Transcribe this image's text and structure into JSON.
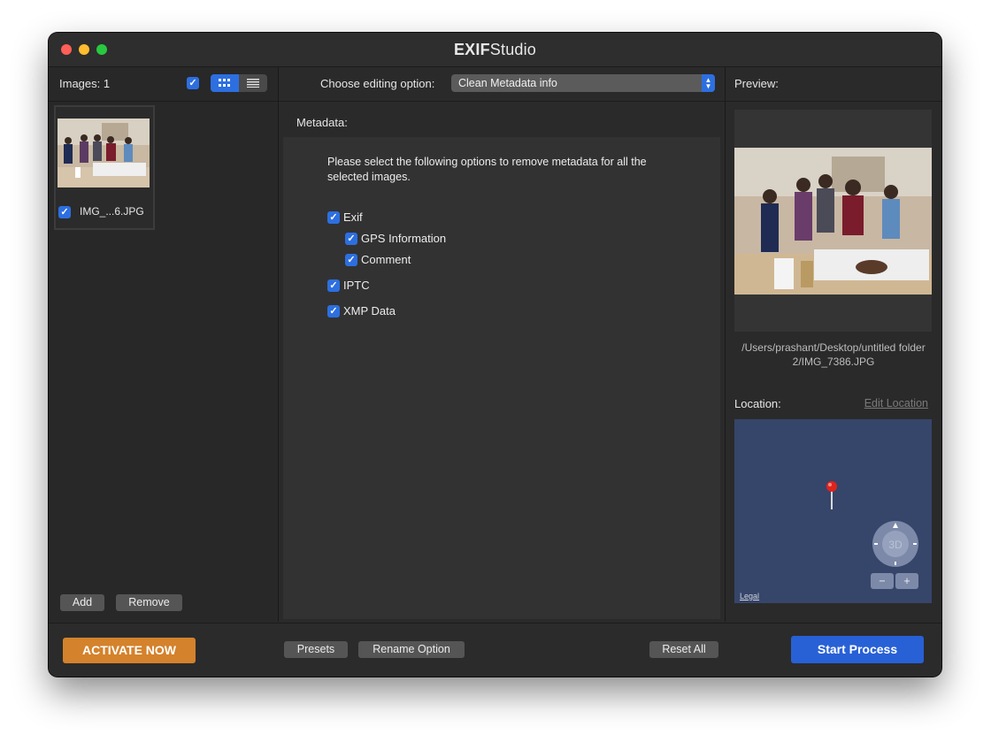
{
  "window": {
    "title_bold": "EXIF",
    "title_rest": "Studio"
  },
  "left": {
    "images_label": "Images:",
    "images_count": "1",
    "thumb_filename": "IMG_...6.JPG",
    "add_label": "Add",
    "remove_label": "Remove"
  },
  "middle": {
    "choose_label": "Choose editing option:",
    "selected_option": "Clean Metadata info",
    "metadata_label": "Metadata:",
    "description": "Please select the following options to remove metadata for all the selected images.",
    "options": {
      "exif": "Exif",
      "gps": "GPS Information",
      "comment": "Comment",
      "iptc": "IPTC",
      "xmp": "XMP Data"
    }
  },
  "right": {
    "preview_label": "Preview:",
    "path": "/Users/prashant/Desktop/untitled folder 2/IMG_7386.JPG",
    "location_label": "Location:",
    "edit_location": "Edit Location",
    "compass_label": "3D",
    "zoom_out": "−",
    "zoom_in": "+",
    "legal": "Legal"
  },
  "bottom": {
    "activate_label": "ACTIVATE NOW",
    "presets_label": "Presets",
    "rename_label": "Rename Option",
    "reset_label": "Reset All",
    "start_label": "Start Process"
  },
  "colors": {
    "accent_blue": "#2d6fe0",
    "activate_orange": "#d4822c",
    "start_blue": "#2860d6",
    "map_bg": "#36456a"
  },
  "icons": [
    "close-window-icon",
    "minimize-window-icon",
    "maximize-window-icon",
    "grid-view-icon",
    "list-view-icon",
    "select-arrows-icon",
    "map-pin-icon",
    "compass-icon",
    "checkmark-icon"
  ]
}
